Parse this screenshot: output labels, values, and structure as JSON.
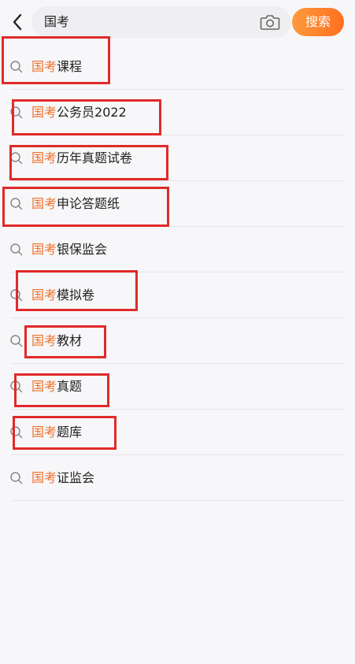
{
  "search": {
    "query": "国考",
    "button_label": "搜索"
  },
  "suggestions": [
    {
      "highlight": "国考",
      "rest": "课程"
    },
    {
      "highlight": "国考",
      "rest": "公务员2022"
    },
    {
      "highlight": "国考",
      "rest": "历年真题试卷"
    },
    {
      "highlight": "国考",
      "rest": "申论答题纸"
    },
    {
      "highlight": "国考",
      "rest": "银保监会"
    },
    {
      "highlight": "国考",
      "rest": "模拟卷"
    },
    {
      "highlight": "国考",
      "rest": "教材"
    },
    {
      "highlight": "国考",
      "rest": "真题"
    },
    {
      "highlight": "国考",
      "rest": "题库"
    },
    {
      "highlight": "国考",
      "rest": "证监会"
    }
  ],
  "colors": {
    "accent": "#f0712a",
    "annotation_box": "#e02a2a"
  },
  "icons": {
    "back": "chevron-left-icon",
    "camera": "camera-icon",
    "suggestion": "search-icon"
  }
}
